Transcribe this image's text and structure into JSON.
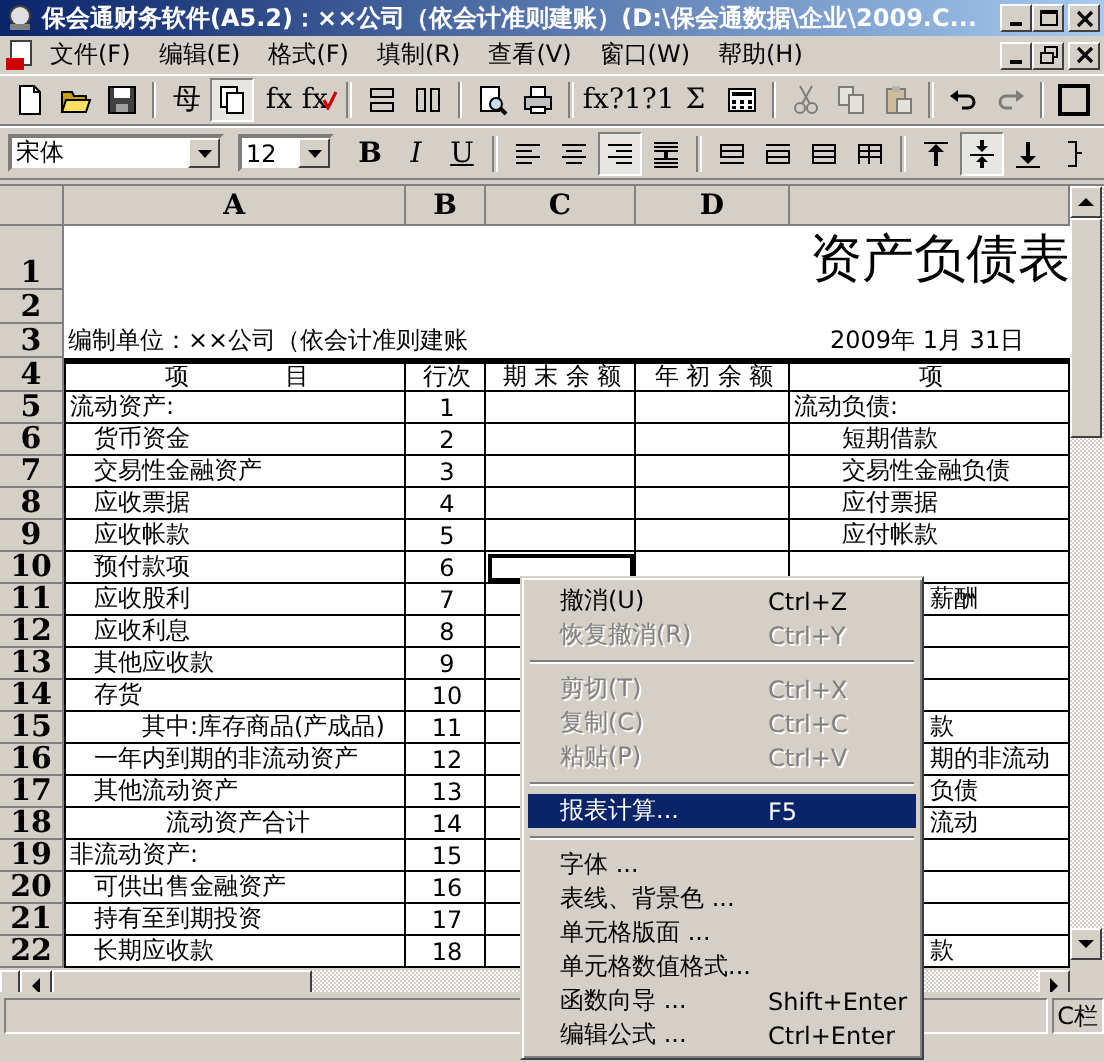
{
  "window": {
    "title": "保会通财务软件(A5.2)：××公司（依会计准则建账）(D:\\保会通数据\\企业\\2009.C..."
  },
  "menu_bar": [
    {
      "label": "文件(F)"
    },
    {
      "label": "编辑(E)"
    },
    {
      "label": "格式(F)"
    },
    {
      "label": "填制(R)"
    },
    {
      "label": "查看(V)"
    },
    {
      "label": "窗口(W)"
    },
    {
      "label": "帮助(H)"
    }
  ],
  "toolbar": [
    {
      "kind": "icon",
      "pressed": false,
      "disabled": false
    },
    {
      "kind": "icon",
      "pressed": false,
      "disabled": false
    },
    {
      "kind": "icon",
      "pressed": false,
      "disabled": false
    },
    {
      "kind": "separator"
    },
    {
      "kind": "text",
      "label": "母",
      "pressed": false,
      "disabled": false
    },
    {
      "kind": "icon",
      "pressed": true,
      "disabled": false
    },
    {
      "kind": "text",
      "label": "fx",
      "pressed": false,
      "disabled": false
    },
    {
      "kind": "text-tick",
      "label": "fx",
      "pressed": false,
      "disabled": false
    },
    {
      "kind": "separator"
    },
    {
      "kind": "icon",
      "pressed": false,
      "disabled": false
    },
    {
      "kind": "icon",
      "pressed": false,
      "disabled": false
    },
    {
      "kind": "separator"
    },
    {
      "kind": "icon",
      "pressed": false,
      "disabled": false
    },
    {
      "kind": "icon",
      "pressed": false,
      "disabled": false
    },
    {
      "kind": "separator"
    },
    {
      "kind": "text",
      "label": "fx?",
      "pressed": false,
      "disabled": false
    },
    {
      "kind": "text",
      "label": "1?1",
      "pressed": false,
      "disabled": false
    },
    {
      "kind": "text",
      "label": "Σ",
      "pressed": false,
      "disabled": false
    },
    {
      "kind": "icon",
      "pressed": false,
      "disabled": false
    },
    {
      "kind": "separator"
    },
    {
      "kind": "icon",
      "pressed": false,
      "disabled": true
    },
    {
      "kind": "icon",
      "pressed": false,
      "disabled": true
    },
    {
      "kind": "icon",
      "pressed": false,
      "disabled": true
    },
    {
      "kind": "separator"
    },
    {
      "kind": "icon",
      "pressed": false,
      "disabled": false
    },
    {
      "kind": "icon",
      "pressed": false,
      "disabled": true
    },
    {
      "kind": "separator"
    },
    {
      "kind": "icon",
      "pressed": false,
      "disabled": false
    }
  ],
  "format_bar": {
    "font": "宋体",
    "size": "12",
    "buttons": [
      {
        "kind": "text",
        "label": "B",
        "pressed": false
      },
      {
        "kind": "text",
        "label": "I",
        "pressed": false
      },
      {
        "kind": "text",
        "label": "U",
        "pressed": false
      },
      {
        "kind": "separator"
      },
      {
        "kind": "icon",
        "pressed": false
      },
      {
        "kind": "icon",
        "pressed": false
      },
      {
        "kind": "icon",
        "pressed": true
      },
      {
        "kind": "icon",
        "pressed": false
      },
      {
        "kind": "separator"
      },
      {
        "kind": "icon",
        "pressed": false
      },
      {
        "kind": "icon",
        "pressed": false
      },
      {
        "kind": "icon",
        "pressed": false
      },
      {
        "kind": "icon",
        "pressed": false
      },
      {
        "kind": "separator"
      },
      {
        "kind": "icon",
        "pressed": false
      },
      {
        "kind": "icon",
        "pressed": true
      },
      {
        "kind": "icon",
        "pressed": false
      },
      {
        "kind": "icon",
        "pressed": false
      }
    ]
  },
  "sheet": {
    "columns": [
      "A",
      "B",
      "C",
      "D"
    ],
    "title_row": {
      "label": "1",
      "title": "资产负债表"
    },
    "blank_row": {
      "label": "2"
    },
    "info_row": {
      "label": "3",
      "company": "编制单位：××公司（依会计准则建账",
      "date": "2009年 1月 31日"
    },
    "header_row": {
      "label": "4",
      "cells": [
        "项　　　　目",
        "行次",
        "期 末 余 额",
        "年 初 余 额",
        "项"
      ]
    },
    "rows": [
      {
        "label": "5",
        "item": "流动资产:",
        "line": "1",
        "right": "流动负债:",
        "cursor": false
      },
      {
        "label": "6",
        "item": "　货币资金",
        "line": "2",
        "right": "　　短期借款",
        "cursor": false
      },
      {
        "label": "7",
        "item": "　交易性金融资产",
        "line": "3",
        "right": "　　交易性金融负债",
        "cursor": false
      },
      {
        "label": "8",
        "item": "　应收票据",
        "line": "4",
        "right": "　　应付票据",
        "cursor": false
      },
      {
        "label": "9",
        "item": "　应收帐款",
        "line": "5",
        "right": "　　应付帐款",
        "cursor": false
      },
      {
        "label": "10",
        "item": "　预付款项",
        "line": "6",
        "cursor": true
      },
      {
        "label": "11",
        "item": "　应收股利",
        "line": "7",
        "right_visible": "薪酬",
        "cursor": false
      },
      {
        "label": "12",
        "item": "　应收利息",
        "line": "8",
        "cursor": false
      },
      {
        "label": "13",
        "item": "　其他应收款",
        "line": "9",
        "cursor": false
      },
      {
        "label": "14",
        "item": "　存货",
        "line": "10",
        "cursor": false
      },
      {
        "label": "15",
        "item": "　　　其中:库存商品(产成品)",
        "line": "11",
        "right_visible": "款",
        "cursor": false
      },
      {
        "label": "16",
        "item": "　一年内到期的非流动资产",
        "line": "12",
        "right_visible": "期的非流动",
        "cursor": false
      },
      {
        "label": "17",
        "item": "　其他流动资产",
        "line": "13",
        "right_visible": "负债",
        "cursor": false
      },
      {
        "label": "18",
        "item": "　　　　流动资产合计",
        "line": "14",
        "right_visible": "流动",
        "cursor": false
      },
      {
        "label": "19",
        "item": "非流动资产:",
        "line": "15",
        "cursor": false
      },
      {
        "label": "20",
        "item": "　可供出售金融资产",
        "line": "16",
        "cursor": false
      },
      {
        "label": "21",
        "item": "　持有至到期投资",
        "line": "17",
        "cursor": false
      },
      {
        "label": "22",
        "item": "　长期应收款",
        "line": "18",
        "right_visible": "款",
        "cursor": false
      }
    ]
  },
  "context_menu": [
    {
      "kind": "item",
      "label": "撤消(U)",
      "shortcut": "Ctrl+Z",
      "disabled": false,
      "selected": false
    },
    {
      "kind": "item",
      "label": "恢复撤消(R)",
      "shortcut": "Ctrl+Y",
      "disabled": true,
      "selected": false
    },
    {
      "kind": "separator"
    },
    {
      "kind": "item",
      "label": "剪切(T)",
      "shortcut": "Ctrl+X",
      "disabled": true,
      "selected": false
    },
    {
      "kind": "item",
      "label": "复制(C)",
      "shortcut": "Ctrl+C",
      "disabled": true,
      "selected": false
    },
    {
      "kind": "item",
      "label": "粘贴(P)",
      "shortcut": "Ctrl+V",
      "disabled": true,
      "selected": false
    },
    {
      "kind": "separator"
    },
    {
      "kind": "item",
      "label": "报表计算...",
      "shortcut": "F5",
      "disabled": false,
      "selected": true
    },
    {
      "kind": "separator"
    },
    {
      "kind": "item",
      "label": "字体 ...",
      "disabled": false,
      "selected": false
    },
    {
      "kind": "item",
      "label": "表线、背景色 ...",
      "disabled": false,
      "selected": false
    },
    {
      "kind": "item",
      "label": "单元格版面 ...",
      "disabled": false,
      "selected": false
    },
    {
      "kind": "item",
      "label": "单元格数值格式...",
      "disabled": false,
      "selected": false
    },
    {
      "kind": "item",
      "label": "函数向导 ...",
      "shortcut": "Shift+Enter",
      "disabled": false,
      "selected": false
    },
    {
      "kind": "item",
      "label": "编辑公式 ...",
      "shortcut": "Ctrl+Enter",
      "disabled": false,
      "selected": false
    }
  ],
  "status_bar": {
    "text": "C栏"
  }
}
